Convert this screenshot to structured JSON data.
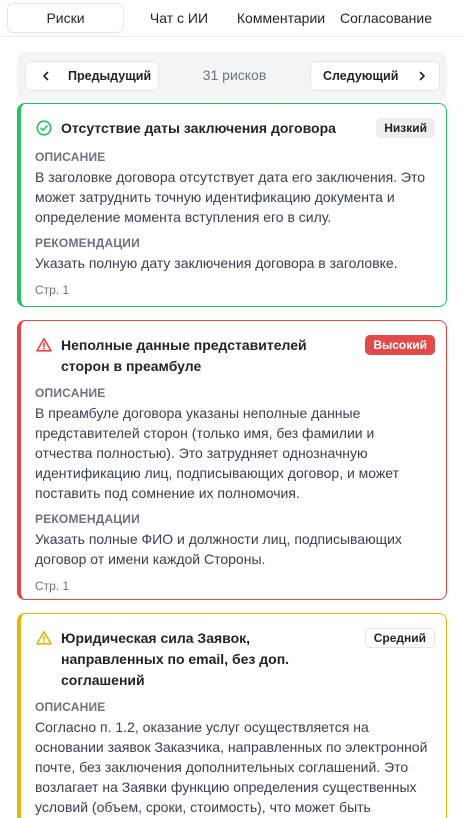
{
  "tabs": [
    {
      "label": "Риски",
      "active": true
    },
    {
      "label": "Чат с ИИ",
      "active": false
    },
    {
      "label": "Комментарии",
      "active": false
    },
    {
      "label": "Согласование",
      "active": false
    }
  ],
  "pager": {
    "prev_label": "Предыдущий",
    "next_label": "Следующий",
    "count_text": "31 рисков"
  },
  "labels": {
    "description": "ОПИСАНИЕ",
    "recommendations": "РЕКОМЕНДАЦИИ"
  },
  "risks": [
    {
      "title": "Отсутствие даты заключения договора",
      "severity": "Низкий",
      "icon": "check-circle-icon",
      "color": "#22c55e",
      "description": "В заголовке договора отсутствует дата его заключения. Это может затруднить точную идентификацию документа и определение момента вступления его в силу.",
      "recommendation": "Указать полную дату заключения договора в заголовке.",
      "page": "Стр. 1"
    },
    {
      "title": "Неполные данные представителей сторон в преамбуле",
      "severity": "Высокий",
      "icon": "warning-triangle-icon",
      "color": "#ef4444",
      "description": "В преамбуле договора указаны неполные данные представителей сторон (только имя, без фамилии и отчества полностью). Это затрудняет однозначную идентификацию лиц, подписывающих договор, и может поставить под сомнение их полномочия.",
      "recommendation": "Указать полные ФИО и должности лиц, подписывающих договор от имени каждой Стороны.",
      "page": "Стр. 1"
    },
    {
      "title": "Юридическая сила Заявок, направленных по email, без доп. соглашений",
      "severity": "Средний",
      "icon": "warning-triangle-icon",
      "color": "#eab308",
      "description": "Согласно п. 1.2, оказание услуг осуществляется на основании заявок Заказчика, направленных по электронной почте, без заключения дополнительных соглашений. Это возлагает на Заявки функцию определения существенных условий (объем, сроки, стоимость), что может быть рискованно, если процесс"
    }
  ]
}
